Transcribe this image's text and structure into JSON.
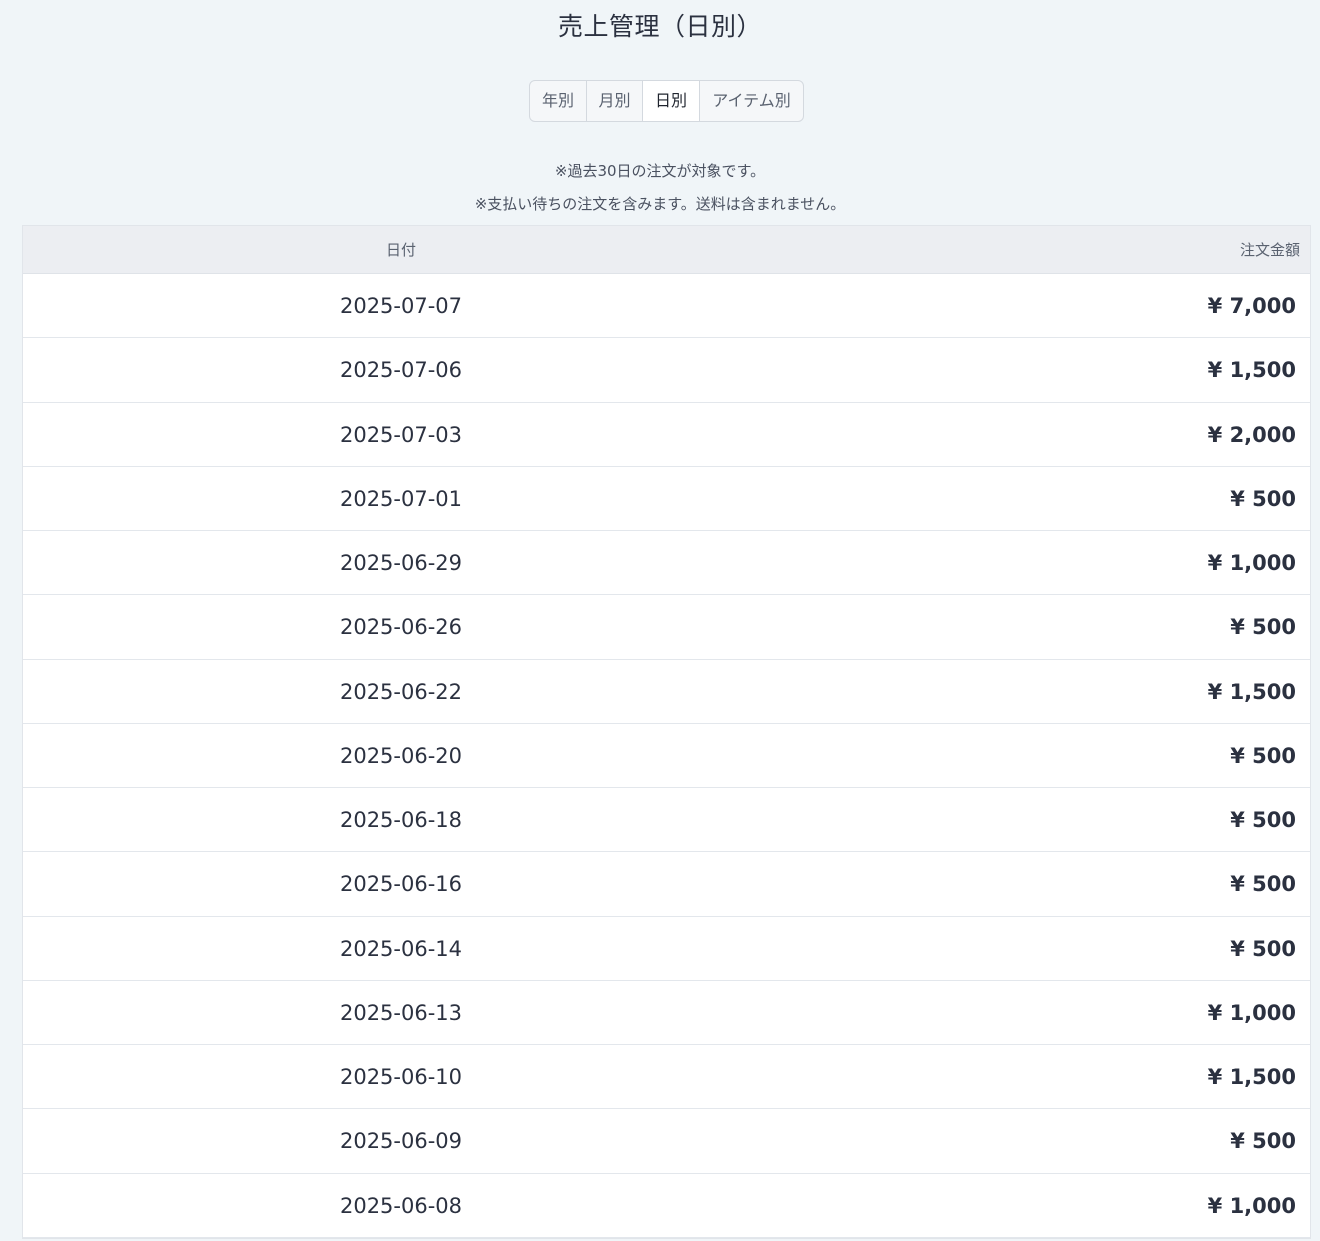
{
  "page": {
    "title": "売上管理（日別）"
  },
  "tabs": [
    {
      "label": "年別",
      "active": false
    },
    {
      "label": "月別",
      "active": false
    },
    {
      "label": "日別",
      "active": true
    },
    {
      "label": "アイテム別",
      "active": false
    }
  ],
  "notes": {
    "line1": "※過去30日の注文が対象です。",
    "line2": "※支払い待ちの注文を含みます。送料は含まれません。"
  },
  "table": {
    "headers": {
      "date": "日付",
      "amount": "注文金額"
    },
    "rows": [
      {
        "date": "2025-07-07",
        "amount": "¥ 7,000"
      },
      {
        "date": "2025-07-06",
        "amount": "¥ 1,500"
      },
      {
        "date": "2025-07-03",
        "amount": "¥ 2,000"
      },
      {
        "date": "2025-07-01",
        "amount": "¥ 500"
      },
      {
        "date": "2025-06-29",
        "amount": "¥ 1,000"
      },
      {
        "date": "2025-06-26",
        "amount": "¥ 500"
      },
      {
        "date": "2025-06-22",
        "amount": "¥ 1,500"
      },
      {
        "date": "2025-06-20",
        "amount": "¥ 500"
      },
      {
        "date": "2025-06-18",
        "amount": "¥ 500"
      },
      {
        "date": "2025-06-16",
        "amount": "¥ 500"
      },
      {
        "date": "2025-06-14",
        "amount": "¥ 500"
      },
      {
        "date": "2025-06-13",
        "amount": "¥ 1,000"
      },
      {
        "date": "2025-06-10",
        "amount": "¥ 1,500"
      },
      {
        "date": "2025-06-09",
        "amount": "¥ 500"
      },
      {
        "date": "2025-06-08",
        "amount": "¥ 1,000"
      }
    ]
  }
}
